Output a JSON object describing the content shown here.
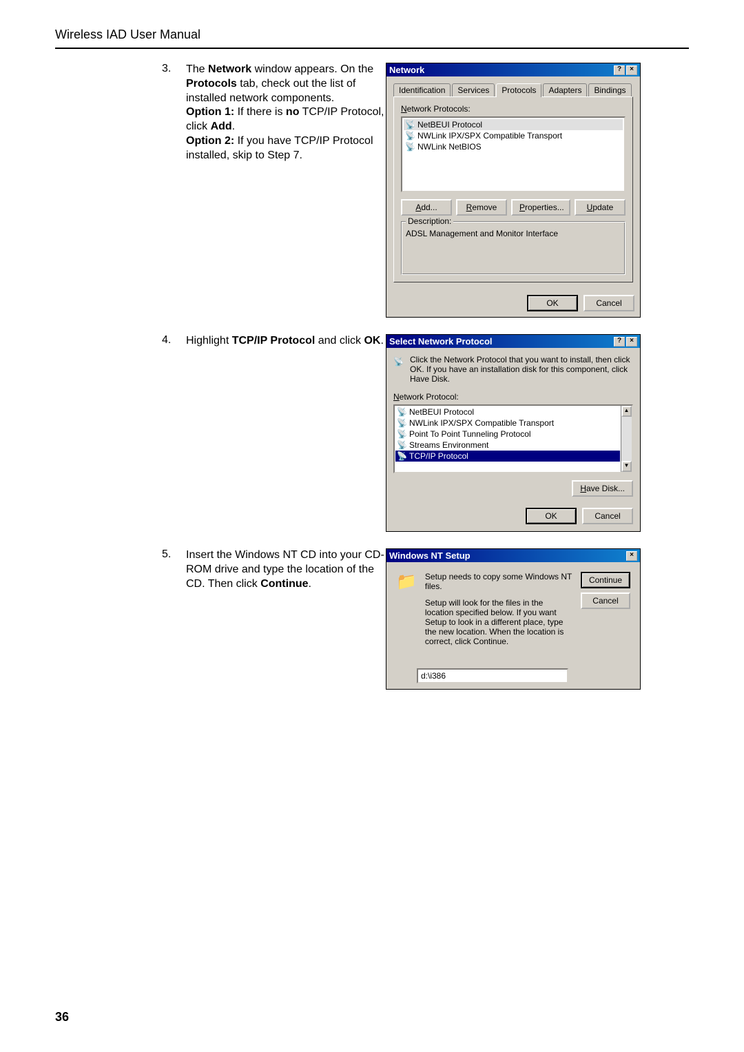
{
  "doc_title": "Wireless IAD User Manual",
  "page_number": "36",
  "steps": {
    "s3": {
      "num": "3.",
      "line1_prefix": "The ",
      "line1_bold": "Network",
      "line1_suffix": " window appears. On the ",
      "line1_bold2": "Protocols",
      "line1_end": " tab, check out the list of installed network components.",
      "opt1_label": "Option 1:",
      "opt1_text": " If there is ",
      "opt1_bold": "no",
      "opt1_text2": " TCP/IP Protocol, click ",
      "opt1_add": "Add",
      "opt1_period": ".",
      "opt2_label": "Option 2:",
      "opt2_text": " If you have TCP/IP Protocol installed, skip to Step 7."
    },
    "s4": {
      "num": "4.",
      "text1": "Highlight ",
      "bold1": "TCP/IP Protocol",
      "text2": " and click ",
      "bold2": "OK",
      "text3": "."
    },
    "s5": {
      "num": "5.",
      "text1": "Insert the Windows NT CD into your CD-ROM drive and type the location of the CD. Then click ",
      "bold1": "Continue",
      "text2": "."
    }
  },
  "network_dialog": {
    "title": "Network",
    "tabs": [
      "Identification",
      "Services",
      "Protocols",
      "Adapters",
      "Bindings"
    ],
    "tab_panel_label": "Network Protocols:",
    "protocols": [
      "NetBEUI Protocol",
      "NWLink IPX/SPX Compatible Transport",
      "NWLink NetBIOS"
    ],
    "buttons": {
      "add": "Add...",
      "remove": "Remove",
      "properties": "Properties...",
      "update": "Update"
    },
    "desc_label": "Description:",
    "desc_text": "ADSL Management and Monitor Interface",
    "ok": "OK",
    "cancel": "Cancel"
  },
  "select_dialog": {
    "title": "Select Network Protocol",
    "instruction": "Click the Network Protocol that you want to install, then click OK.  If you have an installation disk for this component, click Have Disk.",
    "list_label": "Network Protocol:",
    "items": [
      "NetBEUI Protocol",
      "NWLink IPX/SPX Compatible Transport",
      "Point To Point Tunneling Protocol",
      "Streams Environment",
      "TCP/IP Protocol"
    ],
    "have_disk": "Have Disk...",
    "ok": "OK",
    "cancel": "Cancel"
  },
  "nt_setup": {
    "title": "Windows NT Setup",
    "line1": "Setup needs to copy some Windows NT files.",
    "line2": "Setup will look for the files in the location specified below. If you want Setup to look in a different place, type the new location. When the location is correct, click Continue.",
    "input_value": "d:\\i386",
    "continue": "Continue",
    "cancel": "Cancel"
  }
}
